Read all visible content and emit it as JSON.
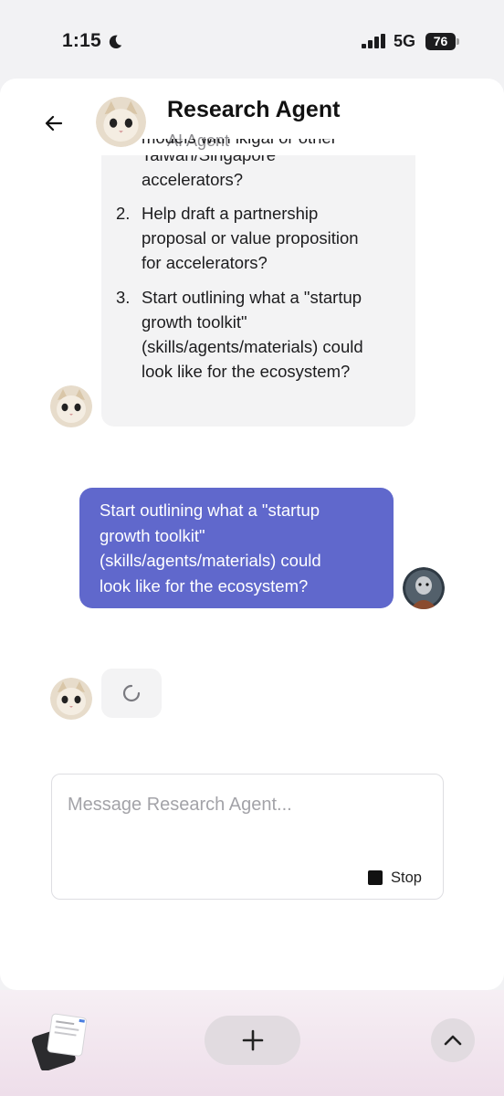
{
  "status_bar": {
    "time": "1:15",
    "network": "5G",
    "battery": "76"
  },
  "header": {
    "title": "Research Agent",
    "subtitle": "AI Agent"
  },
  "agent_message": {
    "clipped_line": "models with ikigai or other",
    "items": [
      {
        "number": "",
        "lines": [
          "Taiwan/Singapore",
          "accelerators?"
        ]
      },
      {
        "number": "2.",
        "lines": [
          "Help draft a partnership",
          "proposal or value proposition",
          "for accelerators?"
        ]
      },
      {
        "number": "3.",
        "lines": [
          "Start outlining what a \"startup",
          "growth toolkit\"",
          "(skills/agents/materials) could",
          "look like for the ecosystem?"
        ]
      }
    ]
  },
  "user_message": {
    "lines": [
      "Start outlining what a \"startup",
      "growth toolkit\"",
      "(skills/agents/materials) could",
      "look like for the ecosystem?"
    ]
  },
  "composer": {
    "placeholder": "Message Research Agent...",
    "stop_label": "Stop"
  },
  "colors": {
    "user_bubble": "#6068cc",
    "agent_bubble": "#f3f3f4"
  },
  "icons": {
    "back": "arrow-left-icon",
    "moon": "moon-icon",
    "signal": "signal-icon",
    "loading": "spinner-icon",
    "plus": "plus-icon",
    "up": "chevron-up-icon"
  }
}
